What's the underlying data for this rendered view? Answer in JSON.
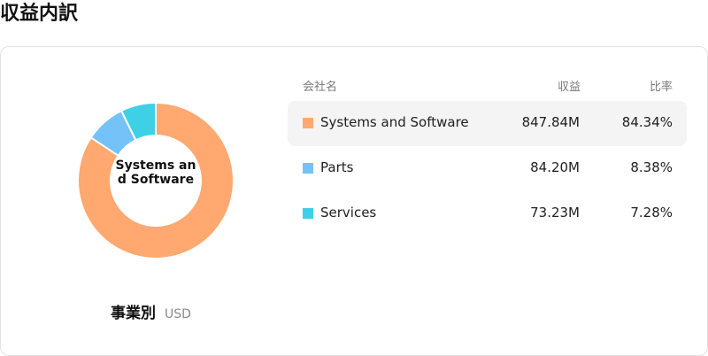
{
  "title": "収益内訳",
  "caption": {
    "main": "事業別",
    "unit": "USD"
  },
  "table": {
    "headers": {
      "name": "会社名",
      "revenue": "収益",
      "ratio": "比率"
    },
    "rows": [
      {
        "name": "Systems and Software",
        "revenue": "847.84M",
        "ratio": "84.34%",
        "color": "#FFA870"
      },
      {
        "name": "Parts",
        "revenue": "84.20M",
        "ratio": "8.38%",
        "color": "#75C2F9"
      },
      {
        "name": "Services",
        "revenue": "73.23M",
        "ratio": "7.28%",
        "color": "#3ED0E6"
      }
    ]
  },
  "chart_data": {
    "type": "pie",
    "donut": true,
    "center_label": "Systems and Software",
    "categories": [
      "Systems and Software",
      "Parts",
      "Services"
    ],
    "values": [
      847.84,
      84.2,
      73.23
    ],
    "percentages": [
      84.34,
      8.38,
      7.28
    ],
    "unit": "USD",
    "colors": [
      "#FFA870",
      "#75C2F9",
      "#3ED0E6"
    ]
  }
}
